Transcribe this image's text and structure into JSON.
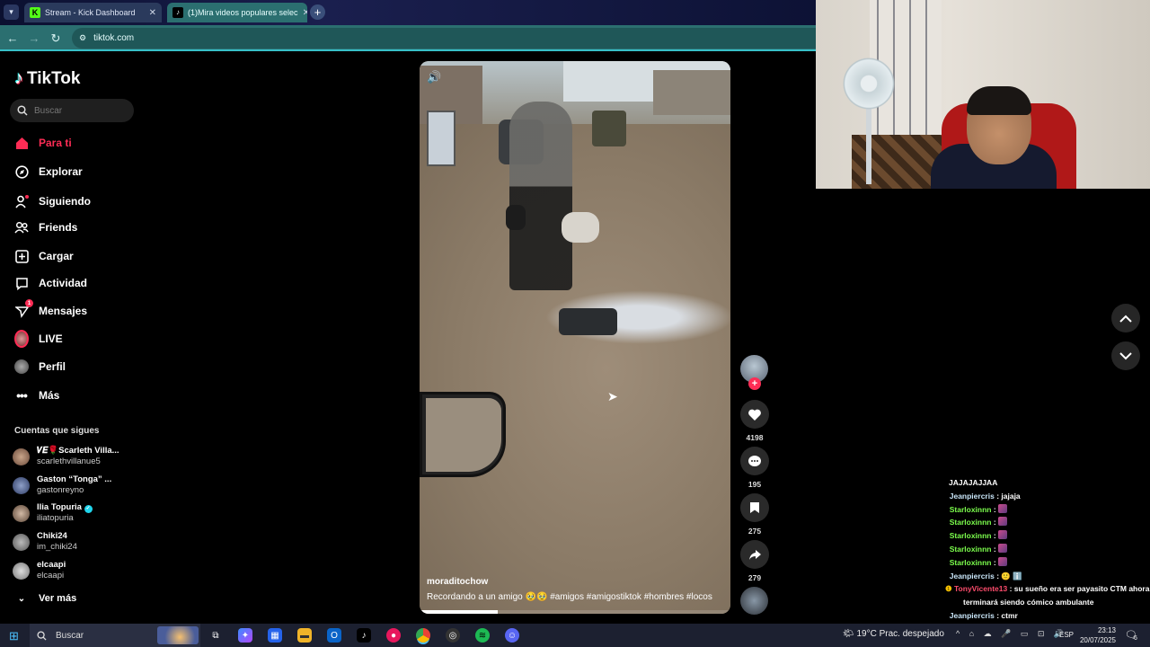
{
  "browser": {
    "tabs": [
      {
        "label": "Stream - Kick Dashboard",
        "favicon_color": "#53fc18"
      },
      {
        "label": "(1)Mira videos populares selec",
        "favicon_color": "#000000"
      }
    ],
    "url": "tiktok.com"
  },
  "sidebar": {
    "logo": "TikTok",
    "search_placeholder": "Buscar",
    "nav": [
      {
        "label": "Para ti",
        "icon": "home-icon",
        "active": true
      },
      {
        "label": "Explorar",
        "icon": "compass-icon"
      },
      {
        "label": "Siguiendo",
        "icon": "following-icon"
      },
      {
        "label": "Friends",
        "icon": "friends-icon"
      },
      {
        "label": "Cargar",
        "icon": "upload-icon"
      },
      {
        "label": "Actividad",
        "icon": "activity-icon"
      },
      {
        "label": "Mensajes",
        "icon": "messages-icon",
        "badge": "1"
      },
      {
        "label": "LIVE",
        "icon": "live-icon"
      },
      {
        "label": "Perfil",
        "icon": "profile-icon"
      },
      {
        "label": "Más",
        "icon": "more-icon"
      }
    ],
    "following_title": "Cuentas que sigues",
    "following": [
      {
        "name": "𝑽𝑬🌹Scarleth Villa...",
        "handle": "scarlethvillanue5"
      },
      {
        "name": "Gaston “Tonga” ...",
        "handle": "gastonreyno"
      },
      {
        "name": "Ilia Topuria",
        "handle": "iliatopuria",
        "verified": true
      },
      {
        "name": "Chiki24",
        "handle": "im_chiki24"
      },
      {
        "name": "elcaapi",
        "handle": "elcaapi"
      }
    ],
    "see_more": "Ver más"
  },
  "video": {
    "username": "moraditochow",
    "caption": "Recordando a un amigo 🥹🥹 #amigos #amigostiktok #hombres #locos",
    "progress": 0.25,
    "likes": "4198",
    "comments": "195",
    "saves": "275",
    "shares": "279"
  },
  "chat": [
    {
      "user": "JAJAJAJJAA",
      "msg": "",
      "color": "header"
    },
    {
      "user": "Jeanpiercris",
      "msg": "jajaja",
      "color": "blue"
    },
    {
      "user": "Starloxinnn",
      "msg": "",
      "emote": true,
      "color": "green"
    },
    {
      "user": "Starloxinnn",
      "msg": "",
      "emote": true,
      "color": "green"
    },
    {
      "user": "Starloxinnn",
      "msg": "",
      "emote": true,
      "color": "green"
    },
    {
      "user": "Starloxinnn",
      "msg": "",
      "emote": true,
      "color": "green"
    },
    {
      "user": "Starloxinnn",
      "msg": "",
      "emote": true,
      "color": "green"
    },
    {
      "user": "Jeanpiercris",
      "msg": "🙂 ℹ️",
      "color": "blue"
    },
    {
      "user": "TonyVicente13",
      "msg": "su sueño era ser payasito CTM ahora",
      "color": "red"
    },
    {
      "user": "",
      "msg": "terminará siendo cómico ambulante",
      "color": "cont"
    },
    {
      "user": "Jeanpiercris",
      "msg": "ctmr",
      "color": "blue"
    }
  ],
  "taskbar": {
    "search": "Buscar",
    "weather": "19°C  Prac. despejado",
    "lang": "ESP",
    "time": "23:13",
    "date": "20/07/2025",
    "notif_count": "6"
  }
}
